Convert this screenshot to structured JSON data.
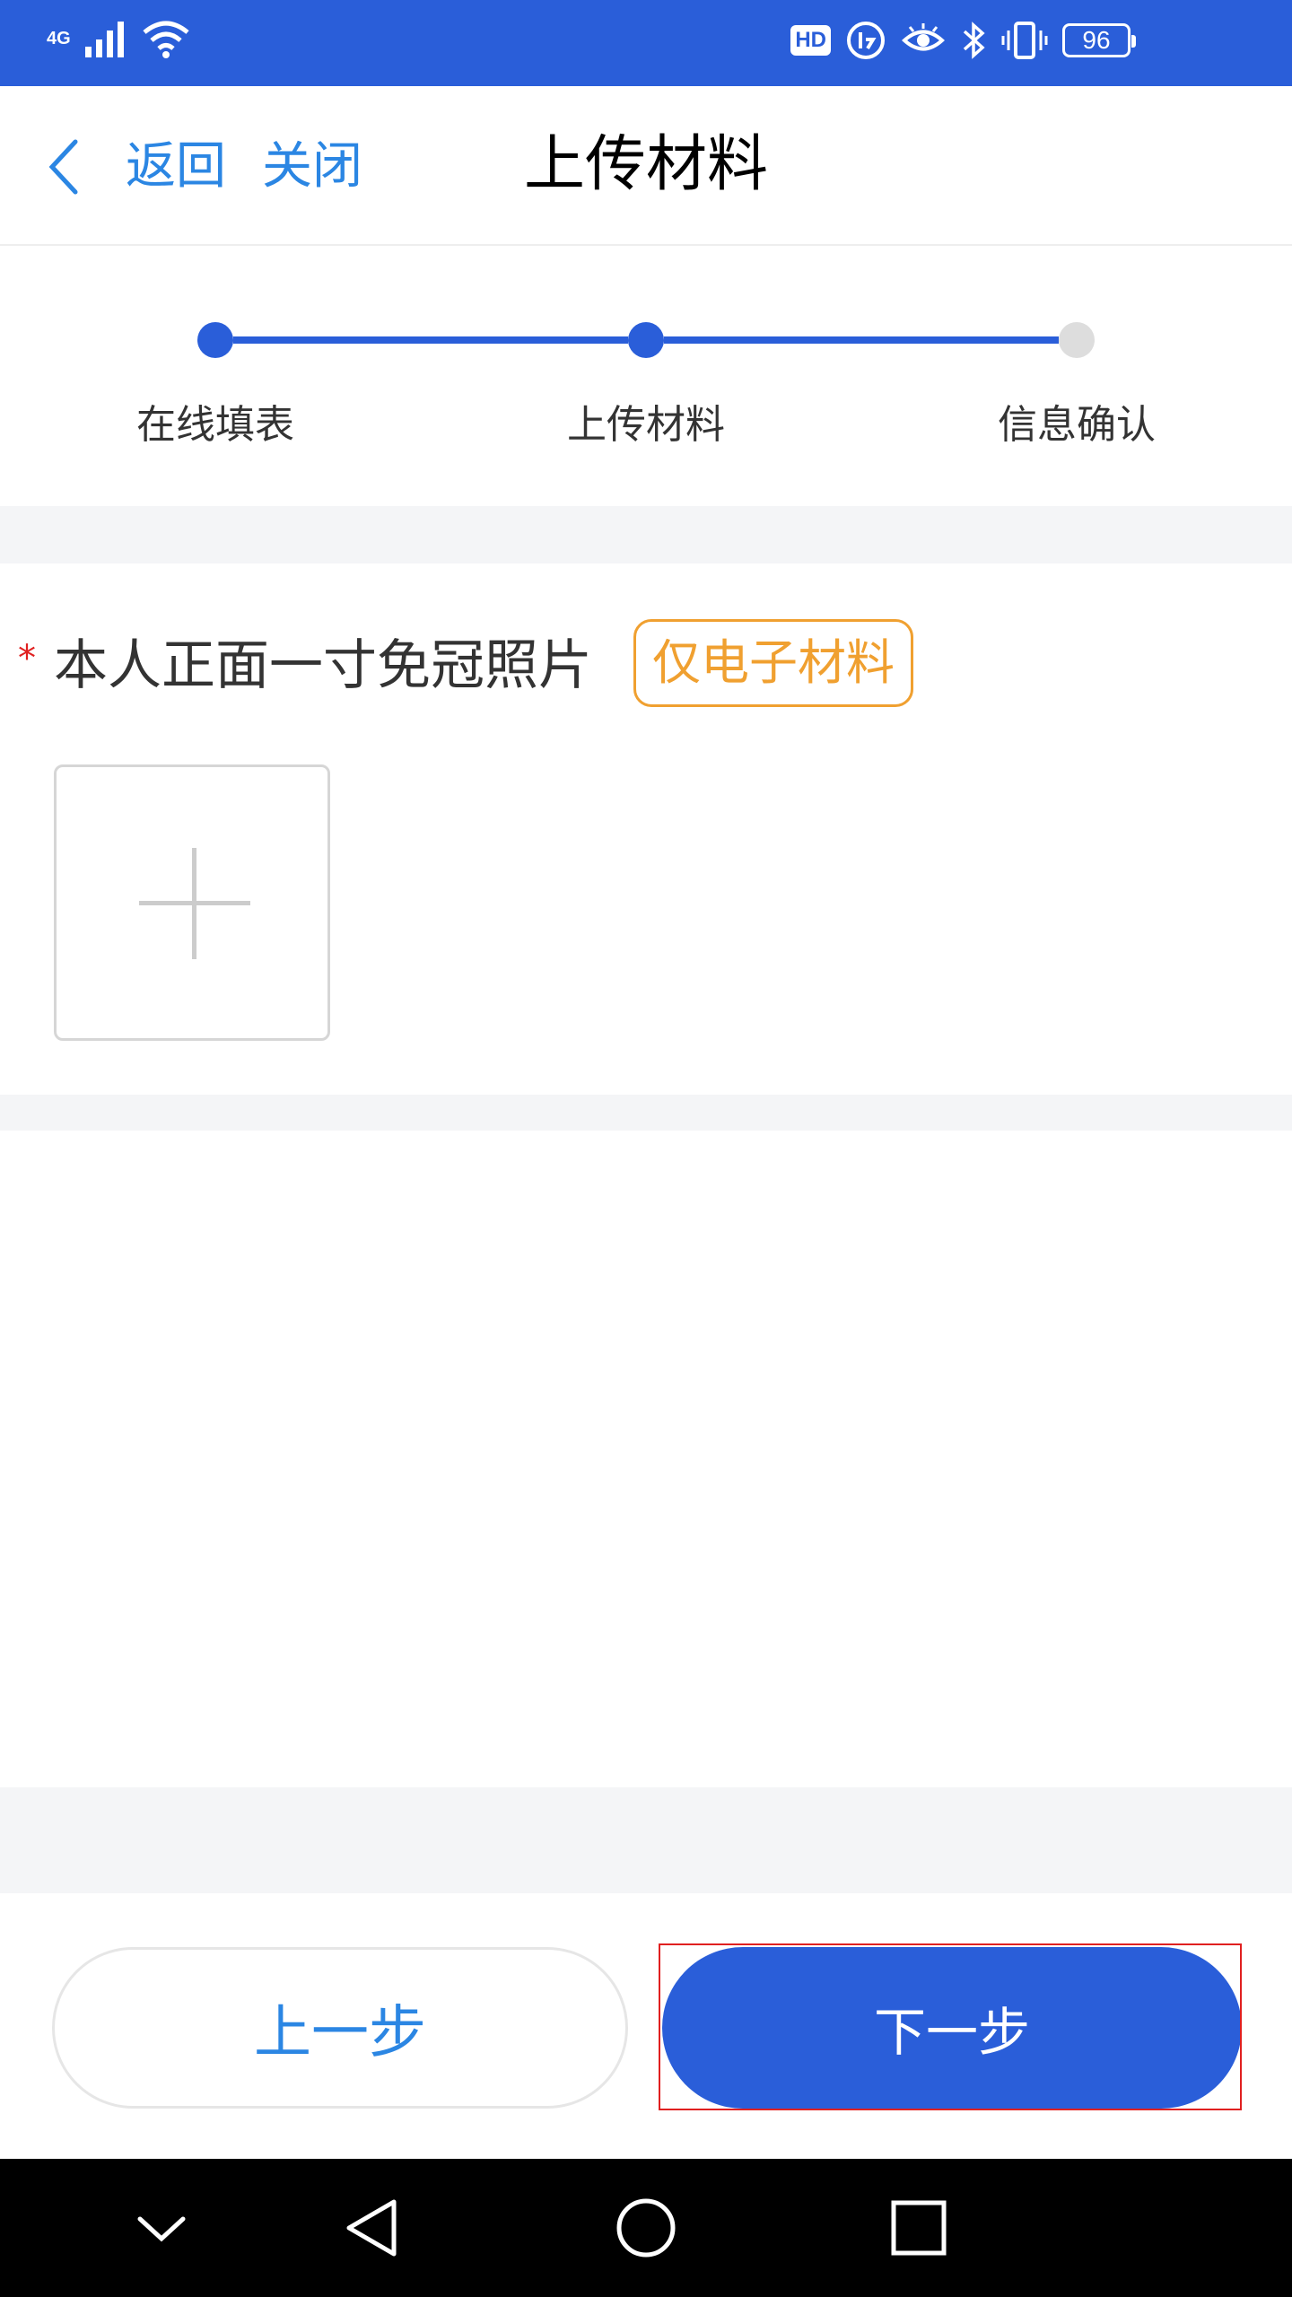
{
  "status_bar": {
    "network": "4G",
    "hd_badge": "HD",
    "battery_level": "96",
    "icons": [
      "signal-icon",
      "wifi-icon",
      "hd-icon",
      "data-saver-icon",
      "eye-comfort-icon",
      "bluetooth-icon",
      "vibrate-icon",
      "battery-icon"
    ]
  },
  "header": {
    "back_label": "返回",
    "close_label": "关闭",
    "title": "上传材料"
  },
  "steps": {
    "items": [
      {
        "label": "在线填表",
        "state": "done"
      },
      {
        "label": "上传材料",
        "state": "active"
      },
      {
        "label": "信息确认",
        "state": "pending"
      }
    ],
    "active_color": "#2a5ed9",
    "inactive_color": "#dddddd"
  },
  "upload_field": {
    "required_mark": "*",
    "label": "本人正面一寸免冠照片",
    "tag": "仅电子材料",
    "add_icon": "plus-icon"
  },
  "footer": {
    "prev_label": "上一步",
    "next_label": "下一步"
  },
  "nav_bar": {
    "icons": [
      "chevron-down-icon",
      "back-triangle-icon",
      "home-circle-icon",
      "recents-square-icon"
    ]
  },
  "colors": {
    "brand": "#2a5ed9",
    "link": "#2b86e3",
    "tag": "#f0a030",
    "required": "#e02020"
  }
}
